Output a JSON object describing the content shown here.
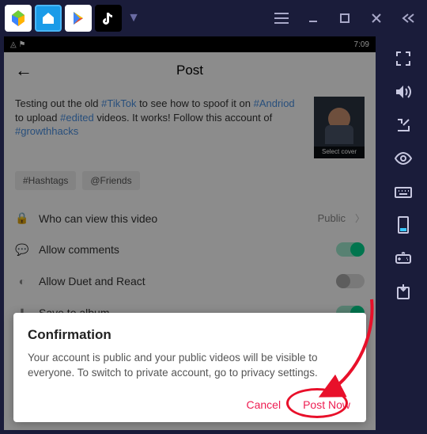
{
  "titlebar": {
    "apps": [
      "BlueStacks",
      "Launcher",
      "Play Store",
      "TikTok"
    ]
  },
  "status": {
    "time": "7:09"
  },
  "header": {
    "title": "Post"
  },
  "caption": {
    "pre": "Testing out the old ",
    "tag1": "#TikTok",
    "mid1": "  to see how to spoof it on ",
    "tag2": "#Andriod",
    "mid2": " to upload ",
    "tag3": "#edited",
    "mid3": " videos. It works! Follow this account of ",
    "tag4": "#growthhacks"
  },
  "thumb": {
    "label": "Select cover"
  },
  "tag_buttons": {
    "hashtags": "#Hashtags",
    "friends": "@Friends"
  },
  "options": {
    "who": {
      "label": "Who can view this video",
      "value": "Public"
    },
    "comments": {
      "label": "Allow comments"
    },
    "duet": {
      "label": "Allow Duet and React"
    },
    "save": {
      "label": "Save to album"
    }
  },
  "dialog": {
    "title": "Confirmation",
    "message": "Your account is public and your public videos will be visible to everyone. To switch to private account, go to privacy settings.",
    "cancel": "Cancel",
    "post": "Post Now"
  }
}
